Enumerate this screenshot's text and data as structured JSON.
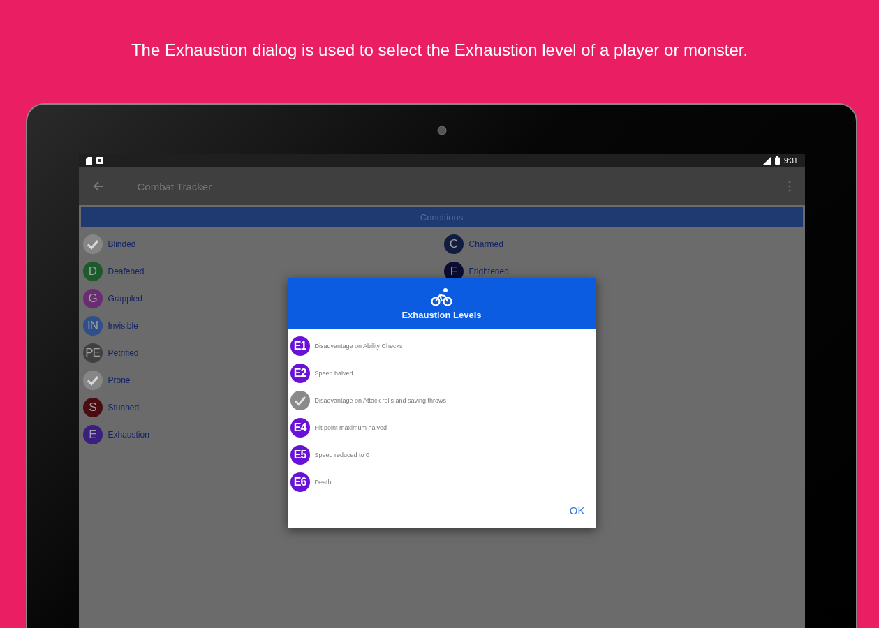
{
  "caption": "The Exhaustion dialog is used to select the Exhaustion level of a player or monster.",
  "status_bar": {
    "time": "9:31"
  },
  "app_bar": {
    "title": "Combat Tracker"
  },
  "conditions": {
    "title": "Conditions",
    "columns": [
      [
        {
          "name": "Blinded",
          "checked": true
        },
        {
          "name": "Deafened",
          "badge": "D",
          "checked": false,
          "color": "#1c5a2c"
        },
        {
          "name": "Grappled",
          "badge": "G",
          "checked": false,
          "color": "#6a2c72"
        },
        {
          "name": "Invisible",
          "badge": "IN",
          "checked": false,
          "color": "#2f4f88"
        },
        {
          "name": "Petrified",
          "badge": "PE",
          "checked": false,
          "color": "#404040"
        },
        {
          "name": "Prone",
          "checked": true
        },
        {
          "name": "Stunned",
          "badge": "S",
          "checked": false,
          "color": "#4a0c10"
        },
        {
          "name": "Exhaustion",
          "badge": "E",
          "checked": false,
          "color": "#3a1e80"
        }
      ],
      [
        {
          "name": "Charmed",
          "badge": "C",
          "checked": false,
          "color": "#101c40"
        },
        {
          "name": "Frightened",
          "badge": "F",
          "checked": false,
          "color": "#0c0c30"
        }
      ]
    ]
  },
  "dialog": {
    "title": "Exhaustion Levels",
    "levels": [
      {
        "badge": "E1",
        "text": "Disadvantage on Ability Checks",
        "checked": false
      },
      {
        "badge": "E2",
        "text": "Speed halved",
        "checked": false
      },
      {
        "text": "Disadvantage on Attack rolls and saving throws",
        "checked": true
      },
      {
        "badge": "E4",
        "text": "Hit point maximum halved",
        "checked": false
      },
      {
        "badge": "E5",
        "text": "Speed reduced to 0",
        "checked": false
      },
      {
        "badge": "E6",
        "text": "Death",
        "checked": false
      }
    ],
    "button": "OK"
  }
}
